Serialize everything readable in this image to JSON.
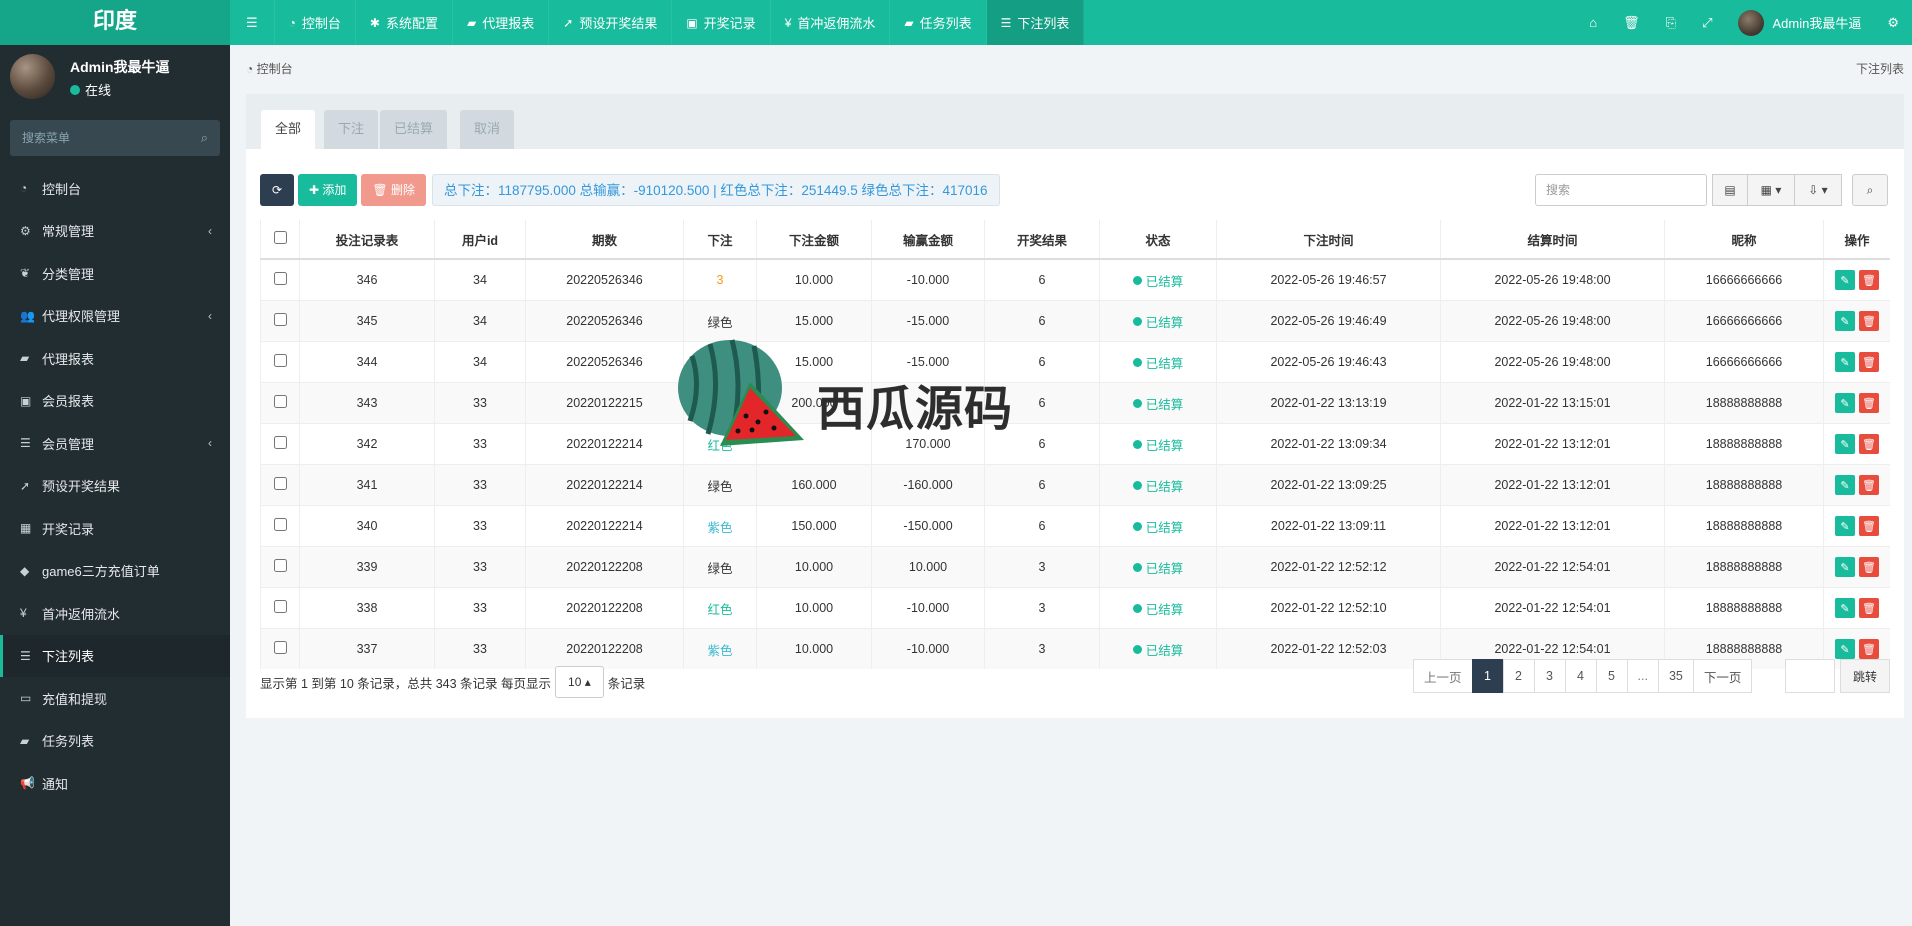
{
  "app": {
    "logo": "印度",
    "nav": [
      {
        "icon": "dashboard-icon",
        "label": "控制台"
      },
      {
        "icon": "gear-icon",
        "label": "系统配置"
      },
      {
        "icon": "book-icon",
        "label": "代理报表"
      },
      {
        "icon": "rocket-icon",
        "label": "预设开奖结果"
      },
      {
        "icon": "calendar-icon",
        "label": "开奖记录"
      },
      {
        "icon": "yen-icon",
        "label": "首冲返佣流水"
      },
      {
        "icon": "book-icon",
        "label": "任务列表"
      },
      {
        "icon": "list-icon",
        "label": "下注列表"
      }
    ],
    "admin_name": "Admin我最牛逼"
  },
  "sidebar": {
    "user_name": "Admin我最牛逼",
    "status": "在线",
    "search_placeholder": "搜索菜单",
    "items": [
      {
        "icon": "dashboard-icon",
        "label": "控制台"
      },
      {
        "icon": "cogs-icon",
        "label": "常规管理",
        "caret": "‹"
      },
      {
        "icon": "leaf-icon",
        "label": "分类管理"
      },
      {
        "icon": "users-icon",
        "label": "代理权限管理",
        "caret": "‹"
      },
      {
        "icon": "book-icon",
        "label": "代理报表"
      },
      {
        "icon": "id-card-icon",
        "label": "会员报表"
      },
      {
        "icon": "list-icon",
        "label": "会员管理",
        "caret": "‹"
      },
      {
        "icon": "rocket-icon",
        "label": "预设开奖结果"
      },
      {
        "icon": "calendar-icon",
        "label": "开奖记录"
      },
      {
        "icon": "diamond-icon",
        "label": "game6三方充值订单"
      },
      {
        "icon": "yen-icon",
        "label": "首冲返佣流水"
      },
      {
        "icon": "list-icon",
        "label": "下注列表",
        "active": true
      },
      {
        "icon": "money-icon",
        "label": "充值和提现"
      },
      {
        "icon": "book-icon",
        "label": "任务列表"
      },
      {
        "icon": "bullhorn-icon",
        "label": "通知"
      }
    ]
  },
  "breadcrumb": {
    "left": "控制台",
    "right": "下注列表"
  },
  "tabs": [
    "全部",
    "下注",
    "已结算",
    "取消"
  ],
  "toolbar": {
    "add_label": "添加",
    "delete_label": "删除",
    "summary": "总下注：1187795.000 总输赢：-910120.500 | 红色总下注：251449.5 绿色总下注：417016",
    "search_placeholder": "搜索"
  },
  "table": {
    "headers": [
      "投注记录表",
      "用户id",
      "期数",
      "下注",
      "下注金额",
      "输赢金额",
      "开奖结果",
      "状态",
      "下注时间",
      "结算时间",
      "昵称",
      "操作"
    ],
    "rows": [
      {
        "id": "346",
        "uid": "34",
        "period": "20220526346",
        "bet": "3",
        "bet_class": "bet-orange",
        "amount": "10.000",
        "win": "-10.000",
        "result": "6",
        "status": "已结算",
        "bet_time": "2022-05-26 19:46:57",
        "settle_time": "2022-05-26 19:48:00",
        "nick": "16666666666"
      },
      {
        "id": "345",
        "uid": "34",
        "period": "20220526346",
        "bet": "绿色",
        "bet_class": "bet-green",
        "amount": "15.000",
        "win": "-15.000",
        "result": "6",
        "status": "已结算",
        "bet_time": "2022-05-26 19:46:49",
        "settle_time": "2022-05-26 19:48:00",
        "nick": "16666666666"
      },
      {
        "id": "344",
        "uid": "34",
        "period": "20220526346",
        "bet": "绿色",
        "bet_class": "bet-green",
        "amount": "15.000",
        "win": "-15.000",
        "result": "6",
        "status": "已结算",
        "bet_time": "2022-05-26 19:46:43",
        "settle_time": "2022-05-26 19:48:00",
        "nick": "16666666666"
      },
      {
        "id": "343",
        "uid": "33",
        "period": "20220122215",
        "bet": "红色",
        "bet_class": "bet-red",
        "amount": "200.000",
        "win": "",
        "result": "6",
        "status": "已结算",
        "bet_time": "2022-01-22 13:13:19",
        "settle_time": "2022-01-22 13:15:01",
        "nick": "18888888888"
      },
      {
        "id": "342",
        "uid": "33",
        "period": "20220122214",
        "bet": "红色",
        "bet_class": "bet-red",
        "amount": "",
        "win": "170.000",
        "result": "6",
        "status": "已结算",
        "bet_time": "2022-01-22 13:09:34",
        "settle_time": "2022-01-22 13:12:01",
        "nick": "18888888888"
      },
      {
        "id": "341",
        "uid": "33",
        "period": "20220122214",
        "bet": "绿色",
        "bet_class": "bet-green",
        "amount": "160.000",
        "win": "-160.000",
        "result": "6",
        "status": "已结算",
        "bet_time": "2022-01-22 13:09:25",
        "settle_time": "2022-01-22 13:12:01",
        "nick": "18888888888"
      },
      {
        "id": "340",
        "uid": "33",
        "period": "20220122214",
        "bet": "紫色",
        "bet_class": "bet-purple",
        "amount": "150.000",
        "win": "-150.000",
        "result": "6",
        "status": "已结算",
        "bet_time": "2022-01-22 13:09:11",
        "settle_time": "2022-01-22 13:12:01",
        "nick": "18888888888"
      },
      {
        "id": "339",
        "uid": "33",
        "period": "20220122208",
        "bet": "绿色",
        "bet_class": "bet-green",
        "amount": "10.000",
        "win": "10.000",
        "result": "3",
        "status": "已结算",
        "bet_time": "2022-01-22 12:52:12",
        "settle_time": "2022-01-22 12:54:01",
        "nick": "18888888888"
      },
      {
        "id": "338",
        "uid": "33",
        "period": "20220122208",
        "bet": "红色",
        "bet_class": "bet-red",
        "amount": "10.000",
        "win": "-10.000",
        "result": "3",
        "status": "已结算",
        "bet_time": "2022-01-22 12:52:10",
        "settle_time": "2022-01-22 12:54:01",
        "nick": "18888888888"
      },
      {
        "id": "337",
        "uid": "33",
        "period": "20220122208",
        "bet": "紫色",
        "bet_class": "bet-purple",
        "amount": "10.000",
        "win": "-10.000",
        "result": "3",
        "status": "已结算",
        "bet_time": "2022-01-22 12:52:03",
        "settle_time": "2022-01-22 12:54:01",
        "nick": "18888888888"
      }
    ]
  },
  "pager": {
    "info_prefix": "显示第 1 到第 10 条记录，总共 343 条记录 每页显示",
    "page_size": "10",
    "info_suffix": "条记录",
    "prev": "上一页",
    "pages": [
      "1",
      "2",
      "3",
      "4",
      "5",
      "...",
      "35"
    ],
    "next": "下一页",
    "jump": "跳转"
  },
  "watermark": {
    "text": "西瓜源码"
  }
}
